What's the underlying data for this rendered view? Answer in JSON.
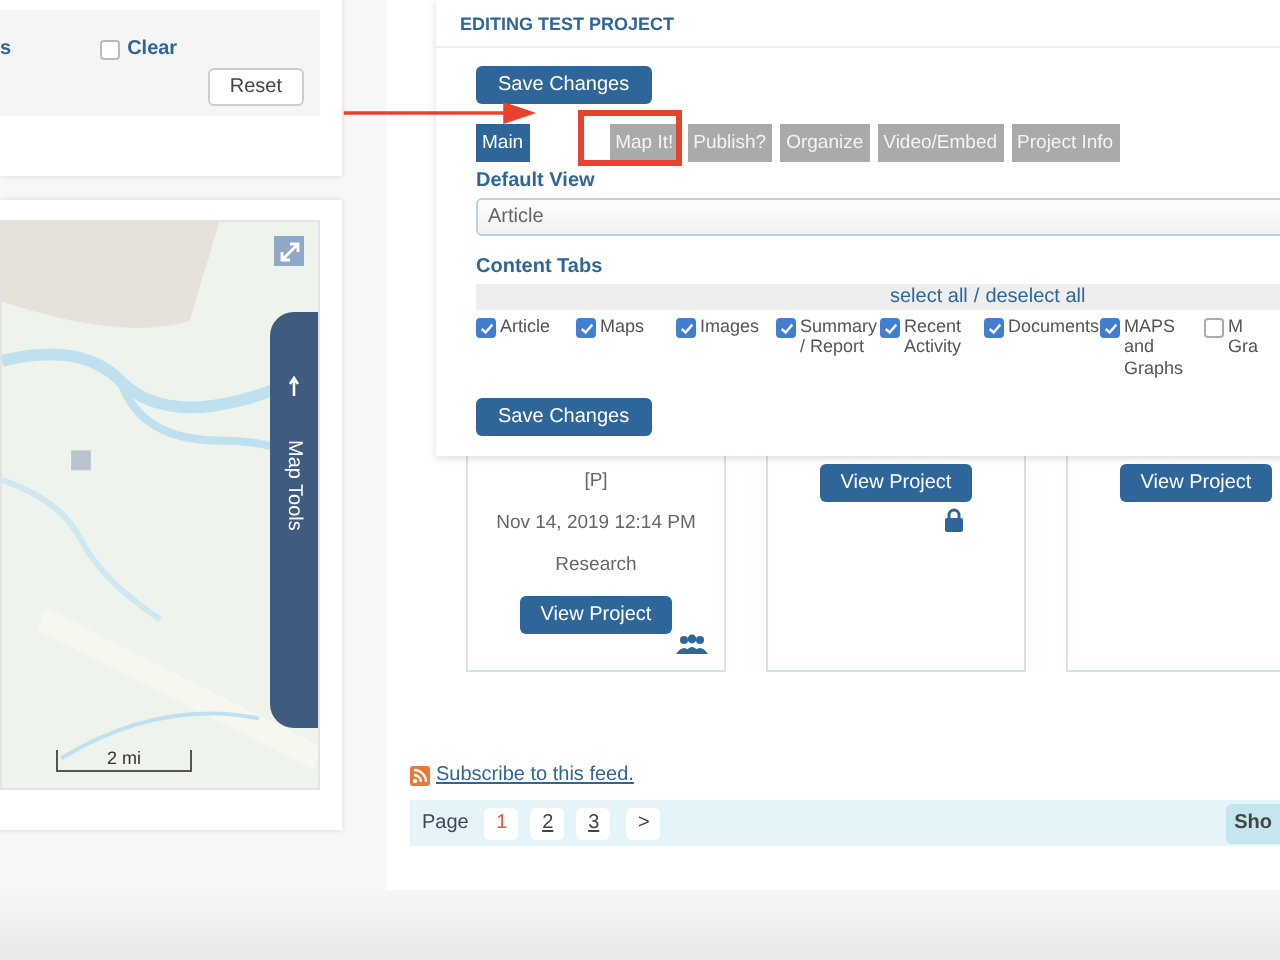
{
  "filter_panel": {
    "label_fragment": "s",
    "clear": {
      "label": "Clear",
      "checked": false
    },
    "reset_button": "Reset"
  },
  "map": {
    "tools_tab": "Map Tools",
    "scale": "2 mi"
  },
  "projects": [
    {
      "tag": "[P]",
      "date": "Nov 14, 2019 12:14 PM",
      "category": "Research",
      "button": "View Project",
      "kind": "group"
    },
    {
      "button": "View Project",
      "kind": "lock"
    },
    {
      "button": "View Project",
      "kind": "plain"
    }
  ],
  "feed_link": "Subscribe to this feed.",
  "pagination": {
    "label": "Page",
    "pages": [
      {
        "label": "1",
        "selected": true
      },
      {
        "label": "2",
        "selected": false
      },
      {
        "label": "3",
        "selected": false
      }
    ],
    "next": ">",
    "show_button": "Sho"
  },
  "editor": {
    "title": "EDITING TEST PROJECT",
    "save_button": "Save Changes",
    "tabs": [
      {
        "label": "Main",
        "selected": true
      },
      {
        "label": "Map It!",
        "selected": false
      },
      {
        "label": "Publish?",
        "selected": false
      },
      {
        "label": "Organize",
        "selected": false
      },
      {
        "label": "Video/Embed",
        "selected": false
      },
      {
        "label": "Project Info",
        "selected": false
      }
    ],
    "default_view": {
      "label": "Default View",
      "value": "Article"
    },
    "content_tabs": {
      "label": "Content Tabs",
      "select_all": "select all",
      "separator": "/",
      "deselect_all": "deselect all",
      "options": [
        {
          "label": "Article",
          "checked": true
        },
        {
          "label": "Maps",
          "checked": true
        },
        {
          "label": "Images",
          "checked": true
        },
        {
          "label": "Summary / Report",
          "checked": true
        },
        {
          "label": "Recent Activity",
          "checked": true
        },
        {
          "label": "Documents",
          "checked": true
        },
        {
          "label": "MAPS and Graphs",
          "checked": true
        },
        {
          "label": "M Gra",
          "checked": false
        }
      ]
    },
    "save_button_bottom": "Save Changes"
  }
}
